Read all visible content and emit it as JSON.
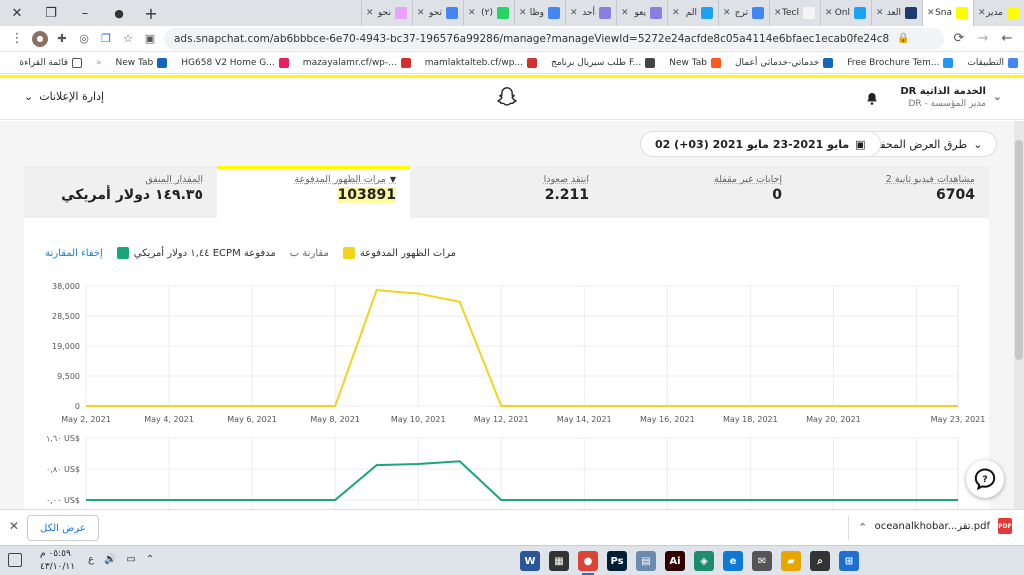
{
  "window": {
    "close_glyph": "✕",
    "restore_glyph": "❐",
    "minimize_glyph": "–",
    "chevron_glyph": "⌄",
    "newtab_glyph": "+"
  },
  "tabs": [
    {
      "label": "مدير",
      "color": "#fffc00"
    },
    {
      "label": "Sna",
      "color": "#fffc00",
      "active": true
    },
    {
      "label": "العد",
      "color": "#1f3a6e"
    },
    {
      "label": "Onl",
      "color": "#1da1f2"
    },
    {
      "label": "Tecl",
      "color": "#f5f5f5"
    },
    {
      "label": "ترج",
      "color": "#4285f4"
    },
    {
      "label": "الم",
      "color": "#1da1f2"
    },
    {
      "label": "يعو",
      "color": "#8a7fe0"
    },
    {
      "label": "أحد",
      "color": "#8a7fe0"
    },
    {
      "label": "وظا",
      "color": "#4285f4"
    },
    {
      "label": "(٢)",
      "color": "#25d366"
    },
    {
      "label": "تحو",
      "color": "#4285f4"
    },
    {
      "label": "نحو",
      "color": "#e8a2ff"
    }
  ],
  "address": {
    "url": "ads.snapchat.com/ab6bbbce-6e70-4943-bc37-196576a99286/manage?manageViewId=5272e24acfde8c05a4114e6bfaec1ecab0fe24c8",
    "lock_glyph": "🔒",
    "back_glyph": "←",
    "forward_glyph": "→",
    "reload_glyph": "⟳",
    "menu_glyph": "⋮",
    "star_glyph": "☆"
  },
  "bookmarks": {
    "apps_label": "التطبيقات",
    "items": [
      {
        "label": "Free Brochure Tem...",
        "color": "#2196f3"
      },
      {
        "label": "خدماتي-خدماتي أعمال",
        "color": "#1565c0"
      },
      {
        "label": "New Tab",
        "color": "#ff5722"
      },
      {
        "label": "طلب سيريال برنامج F...",
        "color": "#444"
      },
      {
        "label": "mamlaktalteb.cf/wp...",
        "color": "#d32f2f"
      },
      {
        "label": "mazayalamr.cf/wp-...",
        "color": "#d32f2f"
      },
      {
        "label": "HG658 V2 Home G...",
        "color": "#e91e63"
      },
      {
        "label": "New Tab",
        "color": "#1565c0"
      }
    ],
    "more_glyph": "»",
    "reading_list_label": "قائمة القراءة"
  },
  "snap_header": {
    "ads_manager_label": "إدارة الإعلانات",
    "account_name": "DR الخدمة الذاتية",
    "account_role": "DR - مدير المؤسسة",
    "bell_glyph": "🔔"
  },
  "filters": {
    "saved_views_label": "طرق العرض المحفوظة",
    "date_range_label": "مايو 2021-23 مايو 2021 (03+) 02"
  },
  "metrics": [
    {
      "label": "مشاهدات فيديو ثانية 2",
      "value": "6704"
    },
    {
      "label": "إجابات غير مقفلة",
      "value": "0"
    },
    {
      "label": "انتقد صعودا",
      "value": "2.211"
    },
    {
      "label": "مرات الظهور المدفوعة",
      "value": "103891",
      "active": true
    },
    {
      "label": "المقدار المنفق",
      "value": "١٤٩.٣٥ دولار أمريكي"
    }
  ],
  "legend": {
    "series1": "مرات الظهور المدفوعة",
    "compare": "مقارنة ب",
    "series2": "١,٤٤ دولار أمريكي ECPM مدفوعة",
    "hide_compare": "إخفاء المقارنة"
  },
  "chart_data": [
    {
      "type": "line",
      "title": "",
      "x": [
        "May 2, 2021",
        "May 3, 2021",
        "May 4, 2021",
        "May 5, 2021",
        "May 6, 2021",
        "May 7, 2021",
        "May 8, 2021",
        "May 9, 2021",
        "May 10, 2021",
        "May 11, 2021",
        "May 12, 2021",
        "May 13, 2021",
        "May 14, 2021",
        "May 15, 2021",
        "May 16, 2021",
        "May 17, 2021",
        "May 18, 2021",
        "May 19, 2021",
        "May 20, 2021",
        "May 21, 2021",
        "May 22, 2021",
        "May 23, 2021"
      ],
      "tick_labels": [
        "May 2, 2021",
        "May 4, 2021",
        "May 6, 2021",
        "May 8, 2021",
        "May 10, 2021",
        "May 12, 2021",
        "May 14, 2021",
        "May 16, 2021",
        "May 18, 2021",
        "May 20, 2021",
        "May 23, 2021"
      ],
      "series": [
        {
          "name": "مرات الظهور المدفوعة",
          "color": "#f2d41c",
          "values": [
            0,
            0,
            0,
            0,
            0,
            0,
            0,
            36700,
            35600,
            33000,
            0,
            0,
            0,
            0,
            0,
            0,
            0,
            0,
            0,
            0,
            0,
            0
          ]
        }
      ],
      "yticks": [
        "38,000",
        "28,500",
        "19,000",
        "9,500",
        "0"
      ],
      "ylim": [
        0,
        38000
      ]
    },
    {
      "type": "line",
      "title": "",
      "x": [
        "May 2, 2021",
        "May 3, 2021",
        "May 4, 2021",
        "May 5, 2021",
        "May 6, 2021",
        "May 7, 2021",
        "May 8, 2021",
        "May 9, 2021",
        "May 10, 2021",
        "May 11, 2021",
        "May 12, 2021",
        "May 13, 2021",
        "May 14, 2021",
        "May 15, 2021",
        "May 16, 2021",
        "May 17, 2021",
        "May 18, 2021",
        "May 19, 2021",
        "May 20, 2021",
        "May 21, 2021",
        "May 22, 2021",
        "May 23, 2021"
      ],
      "series": [
        {
          "name": "١,٤٤ دولار أمريكي ECPM مدفوعة",
          "color": "#1aa57a",
          "values": [
            0,
            0,
            0,
            0,
            0,
            0,
            0,
            0.9,
            0.93,
            1.0,
            0,
            0,
            0,
            0,
            0,
            0,
            0,
            0,
            0,
            0,
            0,
            0
          ]
        }
      ],
      "yticks": [
        "١,٦٠ US$",
        "٠,٨٠ US$",
        "٠,٠٠ US$"
      ],
      "ylim": [
        0,
        1.6
      ]
    }
  ],
  "downloads": {
    "show_all_label": "عرض الكل",
    "filename": "oceanalkhobar...تقر.pdf",
    "pdf_badge": "PDF"
  },
  "taskbar": {
    "time": "٠٥:٥٩ م",
    "date": "٤٣/١٠/١١",
    "lang": "ع",
    "apps": [
      {
        "name": "word",
        "color": "#2b579a",
        "glyph": "W"
      },
      {
        "name": "store",
        "color": "#333",
        "glyph": "▦"
      },
      {
        "name": "chrome",
        "color": "#db4437",
        "glyph": "●",
        "active": true
      },
      {
        "name": "photoshop",
        "color": "#001e36",
        "glyph": "Ps"
      },
      {
        "name": "notepad",
        "color": "#6b8cae",
        "glyph": "▤"
      },
      {
        "name": "illustrator",
        "color": "#330000",
        "glyph": "Ai"
      },
      {
        "name": "camtasia",
        "color": "#1d8b6e",
        "glyph": "◈"
      },
      {
        "name": "edge",
        "color": "#0f7ad6",
        "glyph": "e"
      },
      {
        "name": "mail",
        "color": "#555",
        "glyph": "✉"
      },
      {
        "name": "explorer",
        "color": "#e8a600",
        "glyph": "▰"
      },
      {
        "name": "windows-search",
        "color": "#333",
        "glyph": "⌕"
      },
      {
        "name": "windows-start",
        "color": "#1f6fd0",
        "glyph": "⊞"
      }
    ]
  }
}
